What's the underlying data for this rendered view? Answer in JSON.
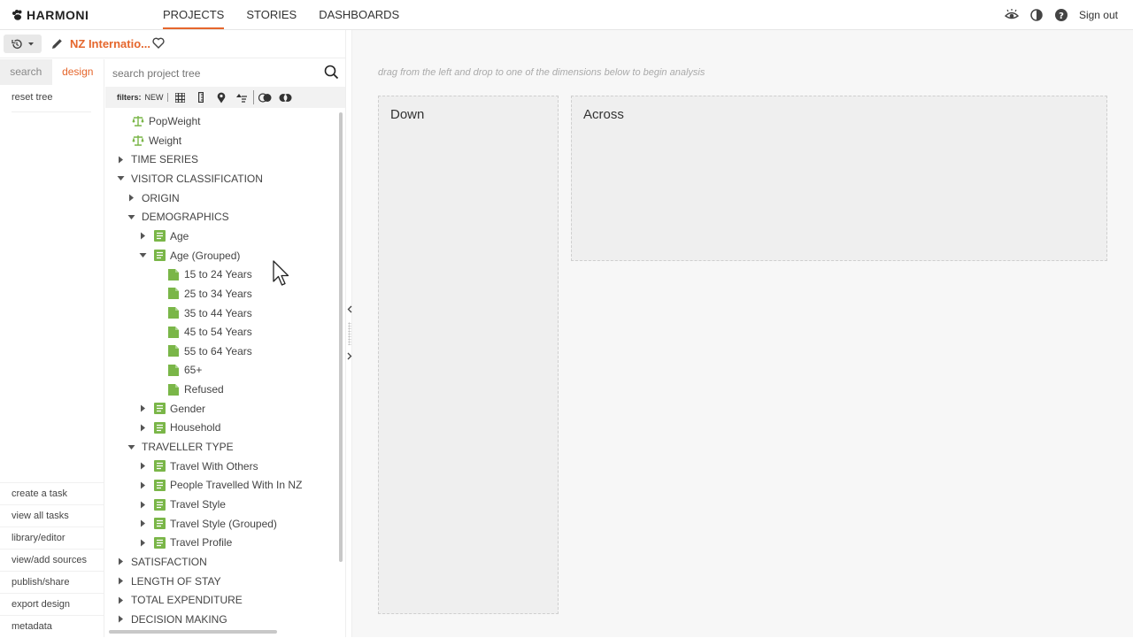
{
  "app": {
    "logo_text": "HARMONI",
    "nav": [
      {
        "label": "PROJECTS",
        "active": true
      },
      {
        "label": "STORIES",
        "active": false
      },
      {
        "label": "DASHBOARDS",
        "active": false
      }
    ],
    "sign_out": "Sign out"
  },
  "project": {
    "title": "NZ Internatio..."
  },
  "leftrail": {
    "tab_search": "search",
    "tab_design": "design",
    "reset_tree": "reset tree",
    "links": [
      "create a task",
      "view all tasks",
      "library/editor",
      "view/add sources",
      "publish/share",
      "export design",
      "metadata"
    ]
  },
  "tree_panel": {
    "search_placeholder": "search project tree",
    "filters_label": "filters:",
    "filters_new": "NEW",
    "nodes": [
      {
        "label": "PopWeight",
        "type": "weight",
        "depth": 1
      },
      {
        "label": "Weight",
        "type": "weight",
        "depth": 1
      },
      {
        "label": "TIME SERIES",
        "type": "folder",
        "depth": 0,
        "expanded": false
      },
      {
        "label": "VISITOR CLASSIFICATION",
        "type": "folder",
        "depth": 0,
        "expanded": true
      },
      {
        "label": "ORIGIN",
        "type": "folder",
        "depth": 1,
        "expanded": false
      },
      {
        "label": "DEMOGRAPHICS",
        "type": "folder",
        "depth": 1,
        "expanded": true
      },
      {
        "label": "Age",
        "type": "variable",
        "depth": 2,
        "expanded": false
      },
      {
        "label": "Age (Grouped)",
        "type": "variable",
        "depth": 2,
        "expanded": true
      },
      {
        "label": "15 to 24 Years",
        "type": "code",
        "depth": 3
      },
      {
        "label": "25 to 34 Years",
        "type": "code",
        "depth": 3
      },
      {
        "label": "35 to 44 Years",
        "type": "code",
        "depth": 3
      },
      {
        "label": "45 to 54 Years",
        "type": "code",
        "depth": 3
      },
      {
        "label": "55 to 64 Years",
        "type": "code",
        "depth": 3
      },
      {
        "label": "65+",
        "type": "code",
        "depth": 3
      },
      {
        "label": "Refused",
        "type": "code",
        "depth": 3
      },
      {
        "label": "Gender",
        "type": "variable",
        "depth": 2,
        "expanded": false
      },
      {
        "label": "Household",
        "type": "variable",
        "depth": 2,
        "expanded": false
      },
      {
        "label": "TRAVELLER TYPE",
        "type": "folder",
        "depth": 1,
        "expanded": true
      },
      {
        "label": "Travel With Others",
        "type": "variable",
        "depth": 2,
        "expanded": false
      },
      {
        "label": "People Travelled With In NZ",
        "type": "variable",
        "depth": 2,
        "expanded": false
      },
      {
        "label": "Travel Style",
        "type": "variable",
        "depth": 2,
        "expanded": false
      },
      {
        "label": "Travel Style (Grouped)",
        "type": "variable",
        "depth": 2,
        "expanded": false
      },
      {
        "label": "Travel Profile",
        "type": "variable",
        "depth": 2,
        "expanded": false
      },
      {
        "label": "SATISFACTION",
        "type": "folder",
        "depth": 0,
        "expanded": false
      },
      {
        "label": "LENGTH OF STAY",
        "type": "folder",
        "depth": 0,
        "expanded": false
      },
      {
        "label": "TOTAL EXPENDITURE",
        "type": "folder",
        "depth": 0,
        "expanded": false
      },
      {
        "label": "DECISION MAKING",
        "type": "folder",
        "depth": 0,
        "expanded": false
      }
    ]
  },
  "main": {
    "hint": "drag from the left and drop to one of the dimensions below to begin analysis",
    "zone_down": "Down",
    "zone_across": "Across"
  },
  "colors": {
    "accent": "#e5662c",
    "green": "#7ab648"
  }
}
